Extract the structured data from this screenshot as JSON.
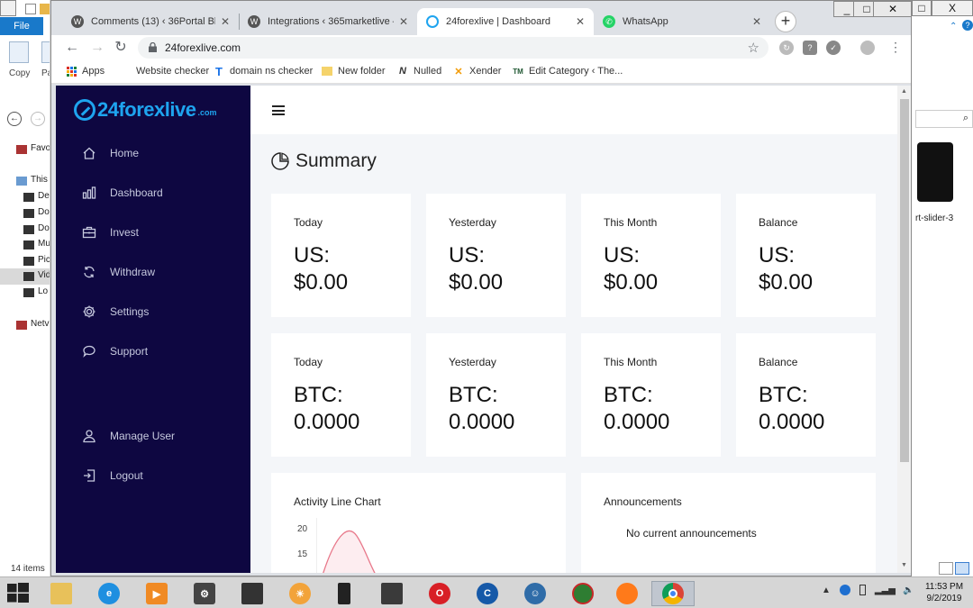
{
  "explorer": {
    "file_tab": "File",
    "copy_label": "Copy",
    "paste_label": "Pa",
    "nav_items": [
      "Favo",
      "This",
      "De",
      "Do",
      "Do",
      "Mu",
      "Pic",
      "Vid",
      "Lo",
      "Netv"
    ],
    "status": "14 items",
    "right_label": "rt-slider-3",
    "window_buttons": [
      "_",
      "□",
      "X"
    ]
  },
  "chrome": {
    "tabs": [
      {
        "title": "Comments (13) ‹ 36Portal Blog",
        "favicon": "wordpress-icon"
      },
      {
        "title": "Integrations ‹ 365marketlive —",
        "favicon": "wordpress-icon"
      },
      {
        "title": "24forexlive | Dashboard",
        "favicon": "24forexlive-icon"
      },
      {
        "title": "WhatsApp",
        "favicon": "whatsapp-icon"
      }
    ],
    "url": "24forexlive.com",
    "bookmarks": [
      {
        "label": "Apps",
        "icon": "apps-grid-icon"
      },
      {
        "label": "Website checker",
        "icon": "blank-page-icon"
      },
      {
        "label": "domain ns checker",
        "icon": "t-letter-icon"
      },
      {
        "label": "New folder",
        "icon": "folder-icon"
      },
      {
        "label": "Nulled",
        "icon": "nulled-icon"
      },
      {
        "label": "Xender",
        "icon": "xender-icon"
      },
      {
        "label": "Edit Category ‹ The...",
        "icon": "tm-icon"
      }
    ]
  },
  "site": {
    "brand": "24forexlive",
    "brand_suffix": ".com",
    "brand_color": "#1ea4ef",
    "sidebar_color": "#0e0741",
    "nav": [
      {
        "label": "Home",
        "icon": "home-icon"
      },
      {
        "label": "Dashboard",
        "icon": "bar-chart-icon"
      },
      {
        "label": "Invest",
        "icon": "briefcase-icon"
      },
      {
        "label": "Withdraw",
        "icon": "refresh-icon"
      },
      {
        "label": "Settings",
        "icon": "gear-icon"
      },
      {
        "label": "Support",
        "icon": "chat-icon"
      }
    ],
    "nav_bottom": [
      {
        "label": "Manage User",
        "icon": "user-icon"
      },
      {
        "label": "Logout",
        "icon": "logout-icon"
      }
    ],
    "summary_title": "Summary",
    "usd_cards": [
      {
        "label": "Today",
        "line1": "US:",
        "line2": "$0.00"
      },
      {
        "label": "Yesterday",
        "line1": "US:",
        "line2": "$0.00"
      },
      {
        "label": "This Month",
        "line1": "US:",
        "line2": "$0.00"
      },
      {
        "label": "Balance",
        "line1": "US:",
        "line2": "$0.00"
      }
    ],
    "btc_cards": [
      {
        "label": "Today",
        "line1": "BTC:",
        "line2": "0.0000"
      },
      {
        "label": "Yesterday",
        "line1": "BTC:",
        "line2": "0.0000"
      },
      {
        "label": "This Month",
        "line1": "BTC:",
        "line2": "0.0000"
      },
      {
        "label": "Balance",
        "line1": "BTC:",
        "line2": "0.0000"
      }
    ],
    "chart_title": "Activity Line Chart",
    "chart_ticks": [
      "20",
      "15"
    ],
    "announcements_title": "Announcements",
    "announcements_empty": "No current announcements"
  },
  "taskbar": {
    "apps": [
      "file-explorer-icon",
      "internet-explorer-icon",
      "media-player-icon",
      "settings-app-icon",
      "terminal-icon",
      "weather-icon",
      "usb-device-icon",
      "dark-app-icon",
      "opera-icon",
      "ccleaner-icon",
      "anonymous-icon",
      "globe-app-icon",
      "firefox-icon",
      "chrome-icon"
    ],
    "time": "11:53 PM",
    "date": "9/2/2019"
  }
}
